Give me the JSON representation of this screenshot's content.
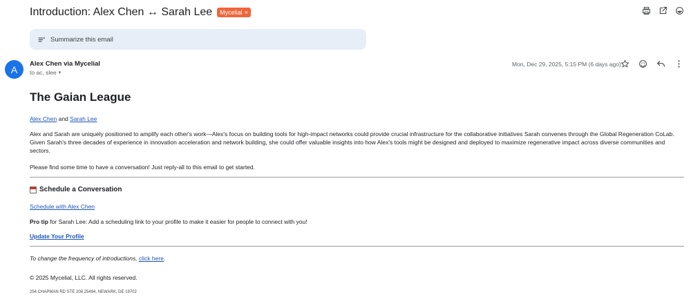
{
  "subject": "Introduction: Alex Chen ↔ Sarah Lee",
  "label_chip": {
    "text": "Mycelial",
    "close": "×"
  },
  "summarize": {
    "label": "Summarize this email"
  },
  "message": {
    "avatar_letter": "A",
    "sender": "Alex Chen via Mycelial",
    "to": "to ac, slee",
    "date": "Mon, Dec 29, 2025, 5:15 PM (6 days ago)"
  },
  "email": {
    "heading": "The Gaian League",
    "names": {
      "a": "Alex Chen",
      "and": "and",
      "b": "Sarah Lee"
    },
    "para1_line1": "Alex and Sarah are uniquely positioned to amplify each other's work—Alex's focus on building tools for high-impact networks could provide crucial infrastructure for the collaborative initiatives Sarah convenes through the Global Regeneration CoLab.",
    "para1_line2": "Given Sarah's three decades of experience in innovation acceleration and network building, she could offer valuable insights into how Alex's tools might be designed and deployed to maximize regenerative impact across diverse communities and",
    "para1_line3": "sectors.",
    "para2": "Please find some time to have a conversation! Just reply-all to this email to get started.",
    "schedule_heading": "Schedule a Conversation",
    "schedule_link": "Schedule with Alex Chen",
    "pro_tip_label": "Pro tip",
    "pro_tip_text": " for Sarah Lee: Add a scheduling link to your profile to make it easier for people to connect with you!",
    "update_profile": "Update Your Profile",
    "frequency_text": "To change the frequency of introductions, ",
    "frequency_link": "click here",
    "frequency_end": ".",
    "copyright": "© 2025 Mycelial, LLC. All rights reserved.",
    "address": "254 CHAPMAN RD STE 208 25494, NEWARK, DE 19702"
  },
  "icons": [
    "print-icon",
    "open-in-new-icon",
    "more-icon",
    "summarize-icon",
    "star-icon",
    "emoji-icon",
    "reply-icon",
    "more-vert-icon",
    "calendar-icon"
  ]
}
